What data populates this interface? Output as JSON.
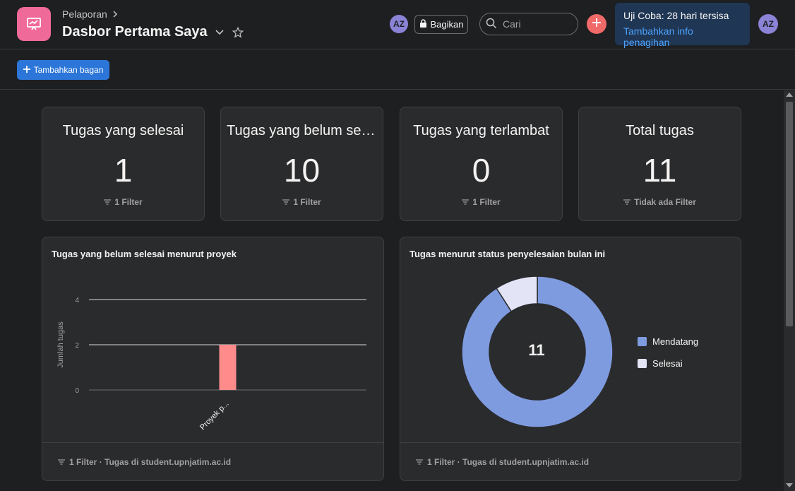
{
  "header": {
    "breadcrumb": "Pelaporan",
    "title": "Dasbor Pertama Saya",
    "avatar_initials": "AZ",
    "share_label": "Bagikan",
    "search_placeholder": "Cari",
    "trial": {
      "status": "Uji Coba: 28 hari tersisa",
      "link": "Tambahkan info penagihan"
    },
    "user_initials": "AZ"
  },
  "toolbar": {
    "add_chart_label": "Tambahkan bagan"
  },
  "stats": [
    {
      "title": "Tugas yang selesai",
      "value": "1",
      "filter": "1 Filter"
    },
    {
      "title": "Tugas yang belum selesai",
      "value": "10",
      "filter": "1 Filter"
    },
    {
      "title": "Tugas yang terlambat",
      "value": "0",
      "filter": "1 Filter"
    },
    {
      "title": "Total tugas",
      "value": "11",
      "filter": "Tidak ada Filter"
    }
  ],
  "charts": {
    "bar": {
      "title": "Tugas yang belum selesai menurut proyek",
      "footer": "1 Filter · Tugas di student.upnjatim.ac.id"
    },
    "donut": {
      "title": "Tugas menurut status penyelesaian bulan ini",
      "center_label": "11",
      "footer": "1 Filter · Tugas di student.upnjatim.ac.id"
    }
  },
  "chart_data": [
    {
      "type": "bar",
      "title": "Tugas yang belum selesai menurut proyek",
      "ylabel": "Jumlah tugas",
      "xlabel": "",
      "categories": [
        "Proyek p..."
      ],
      "values": [
        2
      ],
      "ylim": [
        0,
        4
      ],
      "yticks": [
        0,
        2,
        4
      ],
      "grid": true,
      "colors": [
        "#ff8b8b"
      ]
    },
    {
      "type": "pie",
      "title": "Tugas menurut status penyelesaian bulan ini",
      "center_label": "11",
      "categories": [
        "Mendatang",
        "Selesai"
      ],
      "values": [
        10,
        1
      ],
      "colors": [
        "#7f9be0",
        "#e3e4f6"
      ],
      "legend": "right"
    }
  ]
}
